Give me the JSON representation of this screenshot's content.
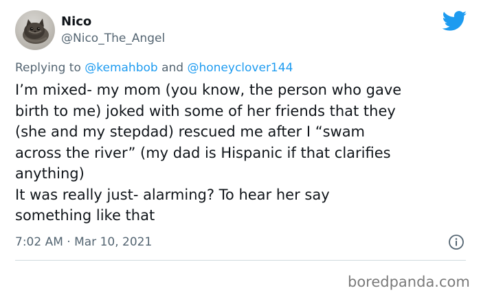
{
  "tweet": {
    "author": {
      "display_name": "Nico",
      "handle": "@Nico_The_Angel"
    },
    "reply": {
      "prefix": "Replying to",
      "mention_1": "@kemahbob",
      "conjunction": "and",
      "mention_2": "@honeyclover144"
    },
    "body_lines": [
      "I’m mixed- my mom (you know, the person who gave",
      "birth to me) joked with some of her friends that they",
      "(she and my stepdad) rescued me after I “swam",
      "across the river” (my dad is Hispanic if that clarifies",
      "anything)",
      "It was really just- alarming? To hear her say",
      "something like that"
    ],
    "timestamp": "7:02 AM · Mar 10, 2021"
  },
  "watermark": "boredpanda.com",
  "colors": {
    "brand_blue": "#1d9bf0",
    "text_primary": "#0f1419",
    "text_secondary": "#536471",
    "divider": "#cfd9de"
  },
  "icons": {
    "logo": "twitter-bird-icon",
    "info": "info-icon"
  }
}
